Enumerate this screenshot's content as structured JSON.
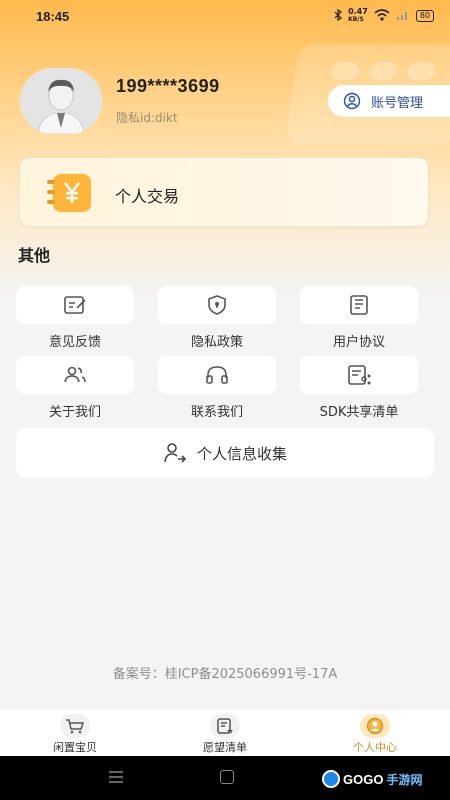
{
  "status_bar": {
    "time": "18:45",
    "speed": "0.47",
    "speed_unit": "KB/S",
    "battery": "80"
  },
  "profile": {
    "phone": "199****3699",
    "privacy_id": "隐私id:dikt",
    "account_button": "账号管理"
  },
  "trade": {
    "label": "个人交易"
  },
  "section": {
    "title": "其他"
  },
  "grid": [
    {
      "label": "意见反馈",
      "icon": "feedback-icon"
    },
    {
      "label": "隐私政策",
      "icon": "shield-icon"
    },
    {
      "label": "用户协议",
      "icon": "document-icon"
    },
    {
      "label": "关于我们",
      "icon": "users-icon"
    },
    {
      "label": "联系我们",
      "icon": "headset-icon"
    },
    {
      "label": "SDK共享清单",
      "icon": "list-share-icon"
    }
  ],
  "collect": {
    "label": "个人信息收集"
  },
  "footer": {
    "icp": "备案号：桂ICP备2025066991号-17A"
  },
  "tabbar": [
    {
      "label": "闲置宝贝",
      "icon": "cart-icon",
      "active": false
    },
    {
      "label": "愿望清单",
      "icon": "wishlist-icon",
      "active": false
    },
    {
      "label": "个人中心",
      "icon": "profile-icon",
      "active": true
    }
  ],
  "watermark": {
    "brand": "GOGO",
    "suffix": "手游网"
  },
  "colors": {
    "accent": "#ffb94c",
    "active_tab": "#d48a1c",
    "link": "#2a4fa8"
  }
}
